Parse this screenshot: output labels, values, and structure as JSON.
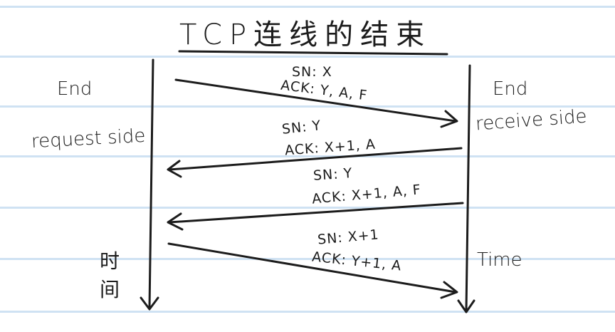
{
  "title": "TCP连线的结束",
  "left_participant": {
    "line1": "End",
    "line2": "request side"
  },
  "right_participant": {
    "line1": "End",
    "line2": "receive side"
  },
  "messages": [
    {
      "sn": "SN: X",
      "ack": "ACK: Y, A, F"
    },
    {
      "sn": "SN: Y",
      "ack": "ACK: X+1, A"
    },
    {
      "sn": "SN: Y",
      "ack": "ACK: X+1, A, F"
    },
    {
      "sn": "SN: X+1",
      "ack": "ACK: Y+1, A"
    }
  ],
  "left_time_label": {
    "char1": "时",
    "char2": "间"
  },
  "right_time_label": "Time",
  "colors": {
    "ink": "#1c1c1c",
    "ruled_line": "#cfe2f3",
    "paper": "#ffffff"
  }
}
